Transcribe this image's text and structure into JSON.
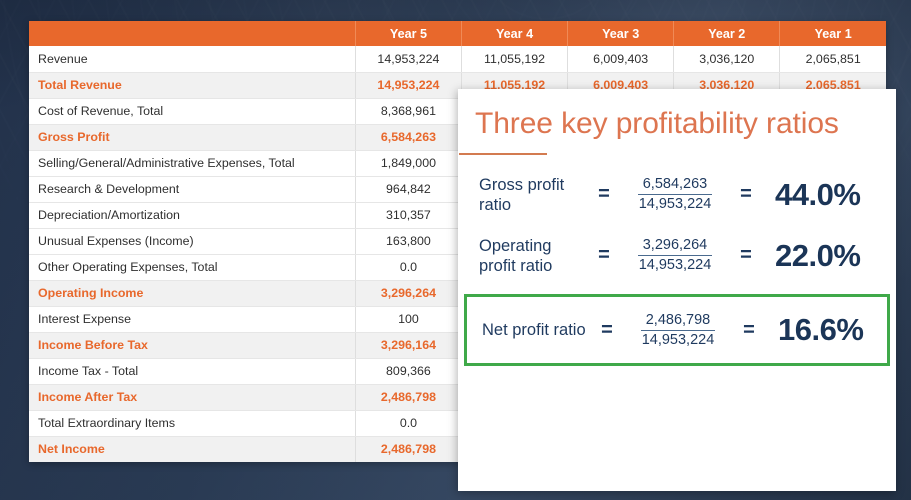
{
  "theme": {
    "background": "#2b3d57",
    "accent_orange": "#e8682c",
    "title_orange": "#dd7550",
    "navy_text": "#1f3a5f",
    "highlight_green": "#3fa949",
    "row_highlight_bg": "#f1f1f1"
  },
  "table": {
    "columns": [
      "",
      "Year 5",
      "Year 4",
      "Year 3",
      "Year 2",
      "Year 1"
    ],
    "rows": [
      {
        "label": "Revenue",
        "highlight": false,
        "values": [
          "14,953,224",
          "11,055,192",
          "6,009,403",
          "3,036,120",
          "2,065,851"
        ]
      },
      {
        "label": "Total Revenue",
        "highlight": true,
        "values": [
          "14,953,224",
          "11,055,192",
          "6,009,403",
          "3,036,120",
          "2,065,851"
        ]
      },
      {
        "label": "Cost of Revenue, Total",
        "highlight": false,
        "values": [
          "8,368,961",
          "",
          "",
          "",
          ""
        ]
      },
      {
        "label": "Gross Profit",
        "highlight": true,
        "values": [
          "6,584,263",
          "",
          "",
          "",
          ""
        ]
      },
      {
        "label": "Selling/General/Administrative Expenses, Total",
        "highlight": false,
        "values": [
          "1,849,000",
          "",
          "",
          "",
          ""
        ]
      },
      {
        "label": "Research & Development",
        "highlight": false,
        "values": [
          "964,842",
          "",
          "",
          "",
          ""
        ]
      },
      {
        "label": "Depreciation/Amortization",
        "highlight": false,
        "values": [
          "310,357",
          "",
          "",
          "",
          ""
        ]
      },
      {
        "label": "Unusual Expenses (Income)",
        "highlight": false,
        "values": [
          "163,800",
          "",
          "",
          "",
          ""
        ]
      },
      {
        "label": "Other Operating Expenses, Total",
        "highlight": false,
        "values": [
          "0.0",
          "",
          "",
          "",
          ""
        ]
      },
      {
        "label": "Operating Income",
        "highlight": true,
        "values": [
          "3,296,264",
          "",
          "",
          "",
          ""
        ]
      },
      {
        "label": "Interest Expense",
        "highlight": false,
        "values": [
          "100",
          "",
          "",
          "",
          ""
        ]
      },
      {
        "label": "Income Before Tax",
        "highlight": true,
        "values": [
          "3,296,164",
          "",
          "",
          "",
          ""
        ]
      },
      {
        "label": "Income Tax - Total",
        "highlight": false,
        "values": [
          "809,366",
          "",
          "",
          "",
          ""
        ]
      },
      {
        "label": "Income After Tax",
        "highlight": true,
        "values": [
          "2,486,798",
          "",
          "",
          "",
          ""
        ]
      },
      {
        "label": "Total Extraordinary Items",
        "highlight": false,
        "values": [
          "0.0",
          "",
          "",
          "",
          ""
        ]
      },
      {
        "label": "Net Income",
        "highlight": true,
        "values": [
          "2,486,798",
          "",
          "",
          "",
          ""
        ]
      }
    ]
  },
  "panel": {
    "title": "Three key profitability ratios",
    "ratios": [
      {
        "name": "Gross profit ratio",
        "eq1": "=",
        "numerator": "6,584,263",
        "denominator": "14,953,224",
        "eq2": "=",
        "result": "44.0%",
        "boxed": false
      },
      {
        "name": "Operating profit ratio",
        "eq1": "=",
        "numerator": "3,296,264",
        "denominator": "14,953,224",
        "eq2": "=",
        "result": "22.0%",
        "boxed": false
      },
      {
        "name": "Net profit ratio",
        "eq1": "=",
        "numerator": "2,486,798",
        "denominator": "14,953,224",
        "eq2": "=",
        "result": "16.6%",
        "boxed": true
      }
    ]
  }
}
